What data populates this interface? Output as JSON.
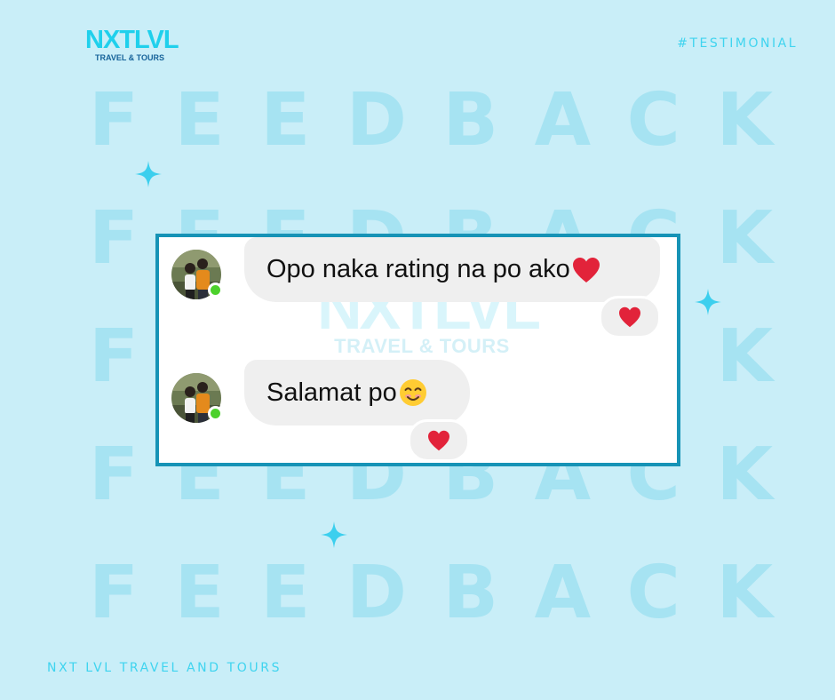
{
  "brand": {
    "logo_main": "NXTLVL",
    "logo_sub": "TRAVEL & TOURS",
    "hashtag": "#TESTIMONIAL",
    "footer": "NXT LVL TRAVEL AND TOURS"
  },
  "background": {
    "letters": [
      "F",
      "E",
      "E",
      "D",
      "B",
      "A",
      "C",
      "K"
    ]
  },
  "colors": {
    "background": "#c9eef8",
    "accent": "#3fd4ef",
    "card_border": "#1693b6",
    "bubble": "#efefef",
    "online": "#4cd12c",
    "heart": "#e2233a"
  },
  "chat": {
    "messages": [
      {
        "text": "Opo naka rating na po ako",
        "emoji": "red-heart-icon",
        "reaction": "red-heart-icon"
      },
      {
        "text": "Salamat po",
        "emoji": "smiling-face-icon",
        "reaction": "red-heart-icon"
      }
    ]
  }
}
